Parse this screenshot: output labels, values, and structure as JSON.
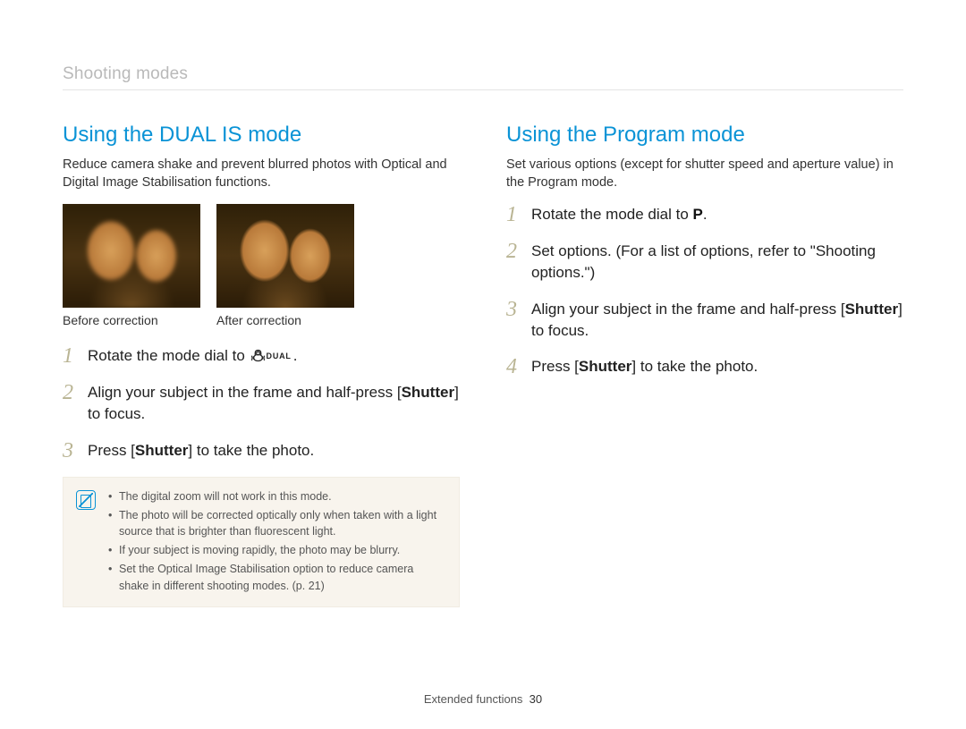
{
  "breadcrumb": "Shooting modes",
  "left": {
    "title": "Using the DUAL IS mode",
    "intro": "Reduce camera shake and prevent blurred photos with Optical and Digital Image Stabilisation functions.",
    "captions": {
      "before": "Before correction",
      "after": "After correction"
    },
    "steps": [
      {
        "num": "1",
        "pre": "Rotate the mode dial to ",
        "icon": "dual-is",
        "post": "."
      },
      {
        "num": "2",
        "pre": "Align your subject in the frame and half-press [",
        "bold": "Shutter",
        "post": "] to focus."
      },
      {
        "num": "3",
        "pre": "Press [",
        "bold": "Shutter",
        "post": "] to take the photo."
      }
    ],
    "notes": [
      "The digital zoom will not work in this mode.",
      "The photo will be corrected optically only when taken with a light source that is brighter than fluorescent light.",
      "If your subject is moving rapidly, the photo may be blurry.",
      "Set the Optical Image Stabilisation option to reduce camera shake in different shooting modes. (p. 21)"
    ]
  },
  "right": {
    "title": "Using the Program mode",
    "intro": "Set various options (except for shutter speed and aperture value) in the Program mode.",
    "steps": [
      {
        "num": "1",
        "pre": "Rotate the mode dial to ",
        "modeP": "P",
        "post": "."
      },
      {
        "num": "2",
        "text": "Set options. (For a list of options, refer to \"Shooting options.\")"
      },
      {
        "num": "3",
        "pre": "Align your subject in the frame and half-press [",
        "bold": "Shutter",
        "post": "] to focus."
      },
      {
        "num": "4",
        "pre": "Press [",
        "bold": "Shutter",
        "post": "] to take the photo."
      }
    ]
  },
  "footer": {
    "section": "Extended functions",
    "page": "30"
  },
  "icons": {
    "dual_label": "DUAL"
  }
}
